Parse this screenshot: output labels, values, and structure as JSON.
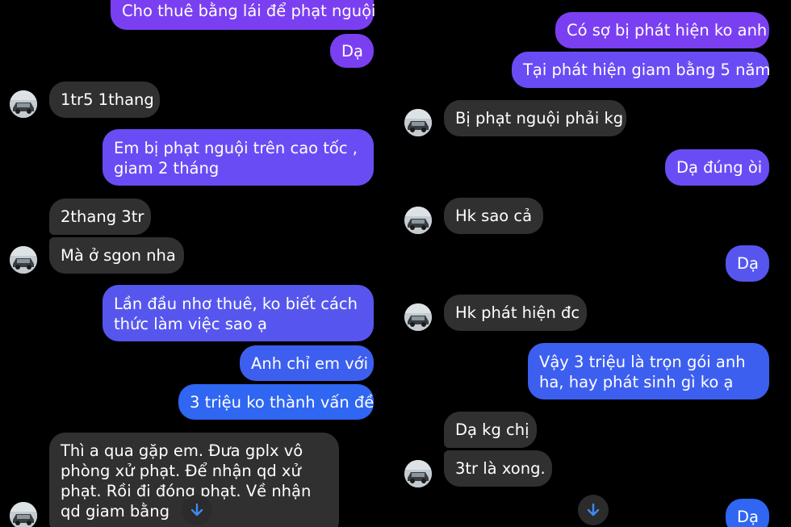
{
  "left": {
    "messages": [
      {
        "text": "Cho thuê bằng lái để phạt nguội"
      },
      {
        "text": "Dạ"
      },
      {
        "text": "1tr5 1thang"
      },
      {
        "text": "Em bị phạt nguội trên cao tốc , giam 2 tháng"
      },
      {
        "text": "2thang 3tr"
      },
      {
        "text": "Mà ở sgon nha"
      },
      {
        "text": "Lần đầu nhơ thuê, ko biết cách thức làm việc sao ạ"
      },
      {
        "text": "Anh chỉ em với"
      },
      {
        "text": "3 triệu ko thành vấn đề"
      },
      {
        "text": "Thì a qua gặp em. Đưa gplx vô phòng xử phạt.  Để nhận qd xử phạt.  Rồi đi đóng phạt. Về nhận qd giam bằng"
      }
    ]
  },
  "right": {
    "messages": [
      {
        "text": "Có sợ bị phát hiện ko anh"
      },
      {
        "text": "Tại phát hiện giam bằng 5 năm"
      },
      {
        "text": "Bị phạt nguội phải kg"
      },
      {
        "text": "Dạ đúng òi"
      },
      {
        "text": "Hk sao cả"
      },
      {
        "text": "Dạ"
      },
      {
        "text": "Hk phát hiện đc"
      },
      {
        "text": "Vậy 3 triệu là trọn gói anh ha, hay phát sinh gì ko ạ"
      },
      {
        "text": "Dạ kg chị"
      },
      {
        "text": "3tr là xong."
      },
      {
        "text": "Dạ"
      }
    ]
  },
  "icons": {
    "avatar": "car-avatar-icon",
    "scroll": "arrow-down-icon"
  },
  "colors": {
    "background": "#000000",
    "incoming": "#303030",
    "outgoing_top": "#7b3ff2",
    "outgoing_bottom": "#2f66f2",
    "scroll_arrow": "#3d8bf5"
  }
}
